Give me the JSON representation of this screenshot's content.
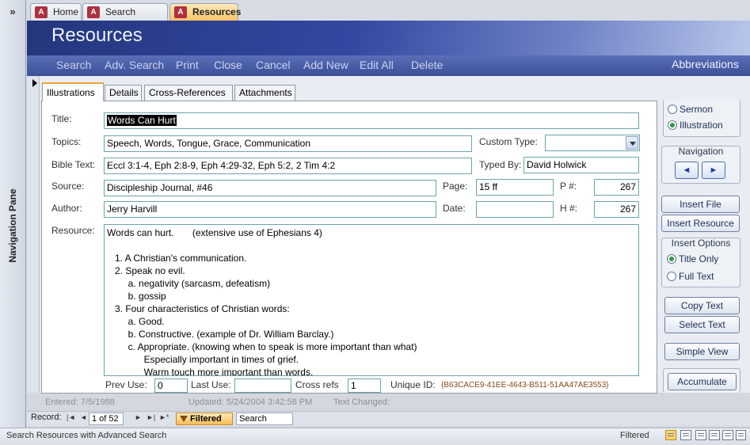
{
  "nav_pane": {
    "toggle": "»",
    "label": "Navigation Pane"
  },
  "doc_tabs": [
    {
      "label": "Home"
    },
    {
      "label": "Search Results"
    },
    {
      "label": "Resources"
    }
  ],
  "header": {
    "title": "Resources"
  },
  "toolbar": {
    "items": [
      "Search",
      "Adv. Search",
      "Print",
      "Close",
      "Cancel",
      "Add New",
      "Edit All",
      "Delete"
    ],
    "abbreviations": "Abbreviations"
  },
  "form_tabs": [
    "Illustrations",
    "Details",
    "Cross-References",
    "Attachments"
  ],
  "fields": {
    "title_label": "Title:",
    "title": "Words Can Hurt",
    "topics_label": "Topics:",
    "topics": "Speech, Words, Tongue, Grace, Communication",
    "custom_type_label": "Custom Type:",
    "custom_type": "",
    "bible_text_label": "Bible Text:",
    "bible_text": "Eccl 3:1-4, Eph 2:8-9, Eph 4:29-32, Eph 5:2, 2 Tim 4:2",
    "typed_by_label": "Typed By:",
    "typed_by": "David Holwick",
    "source_label": "Source:",
    "source": "Discipleship Journal, #46",
    "page_label": "Page:",
    "page": "15 ff",
    "p_num_label": "P #:",
    "p_num": "267",
    "author_label": "Author:",
    "author": "Jerry Harvill",
    "date_label": "Date:",
    "date": "",
    "h_num_label": "H #:",
    "h_num": "267",
    "resource_label": "Resource:",
    "resource_lines": [
      "Words can hurt.       (extensive use of Ephesians 4)",
      "",
      "   1. A Christian's communication.",
      "   2. Speak no evil.",
      "        a. negativity (sarcasm, defeatism)",
      "        b. gossip",
      "   3. Four characteristics of Christian words:",
      "        a. Good.",
      "        b. Constructive. (example of Dr. William Barclay.)",
      "        c. Appropriate. (knowing when to speak is more important than what)",
      "              Especially important in times of grief.",
      "              Warm touch more important than words."
    ],
    "prev_use_label": "Prev Use:",
    "prev_use": "0",
    "last_use_label": "Last Use:",
    "last_use": "",
    "cross_refs_label": "Cross refs",
    "cross_refs": "1",
    "unique_id_label": "Unique ID:",
    "unique_id": "{B63CACE9-41EE-4643-B511-51AA47AE3553}"
  },
  "meta": {
    "entered_label": "Entered:",
    "entered": "7/5/1988",
    "updated_label": "Updated:",
    "updated": "5/24/2004 3:42:58 PM",
    "text_changed_label": "Text Changed:"
  },
  "right_panel": {
    "type_options": [
      {
        "label": "Sermon",
        "selected": false
      },
      {
        "label": "Illustration",
        "selected": true
      }
    ],
    "navigation_title": "Navigation",
    "nav_prev": "◄",
    "nav_next": "►",
    "insert_file": "Insert File",
    "insert_resource": "Insert Resource",
    "insert_options_title": "Insert Options",
    "insert_options": [
      {
        "label": "Title Only",
        "selected": true
      },
      {
        "label": "Full Text",
        "selected": false
      }
    ],
    "copy_text": "Copy Text",
    "select_text": "Select Text",
    "simple_view": "Simple View",
    "accumulate": "Accumulate"
  },
  "record_nav": {
    "label": "Record:",
    "first": "|◄",
    "prev": "◄",
    "current": "1 of 52",
    "next": "►",
    "last": "►|",
    "new": "►*",
    "filter": "Filtered",
    "search": "Search"
  },
  "status_bar": {
    "text": "Search Resources with Advanced Search",
    "filtered": "Filtered"
  },
  "colors": {
    "header_dark": "#24367d",
    "toolbar": "#3c4f98",
    "field_border": "#6fa2a8",
    "active_tab": "#f7c56a",
    "radio_on": "#2c9a44"
  }
}
